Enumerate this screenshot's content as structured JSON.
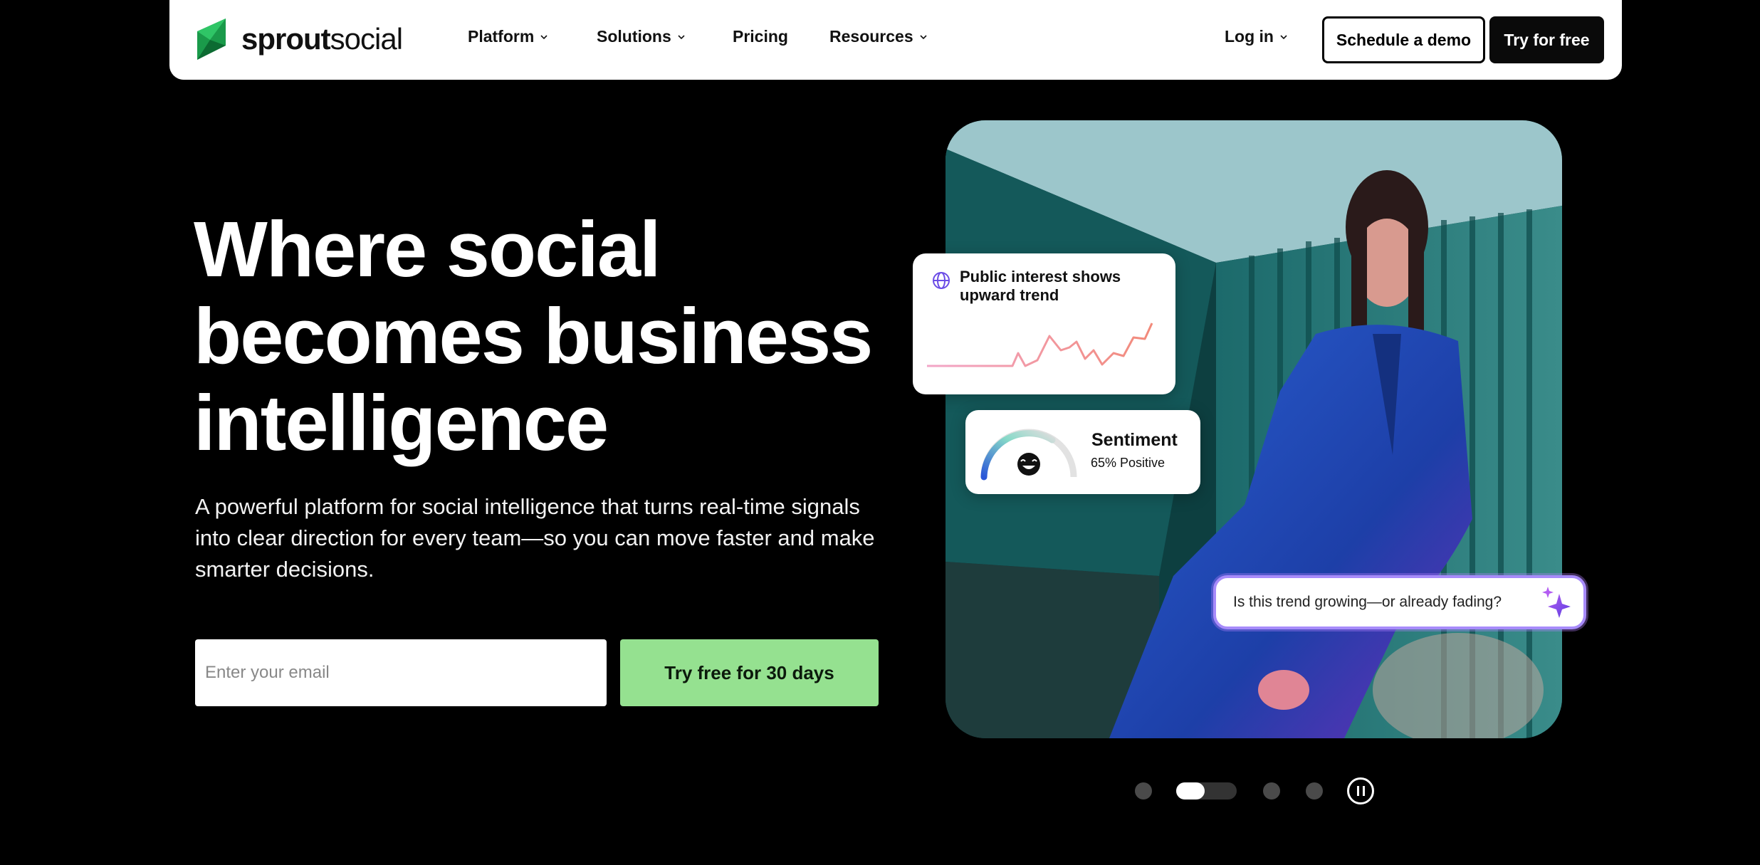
{
  "nav": {
    "logo_bold": "sprout",
    "logo_light": "social",
    "items": [
      {
        "label": "Platform",
        "has_dropdown": true
      },
      {
        "label": "Solutions",
        "has_dropdown": true
      },
      {
        "label": "Pricing",
        "has_dropdown": false
      },
      {
        "label": "Resources",
        "has_dropdown": true
      }
    ],
    "login_label": "Log in",
    "demo_label": "Schedule a demo",
    "try_label": "Try for free"
  },
  "hero": {
    "headline_line1": "Where social",
    "headline_line2": "becomes business",
    "headline_line3": "intelligence",
    "subtext": "A powerful platform for social intelligence that turns real-time signals into clear direction for every team—so you can move faster and make smarter decisions.",
    "email_placeholder": "Enter your email",
    "cta_label": "Try free for 30 days"
  },
  "media": {
    "trend_title": "Public interest shows upward trend",
    "sentiment_label": "Sentiment",
    "sentiment_value": "65% Positive",
    "prompt_text": "Is this trend growing—or already fading?"
  },
  "carousel": {
    "slide_count": 4,
    "active_index": 1
  },
  "colors": {
    "accent_green": "#95e190",
    "brand_green": "#1fa055",
    "background": "#000000",
    "prompt_border": "#a78bfa"
  }
}
